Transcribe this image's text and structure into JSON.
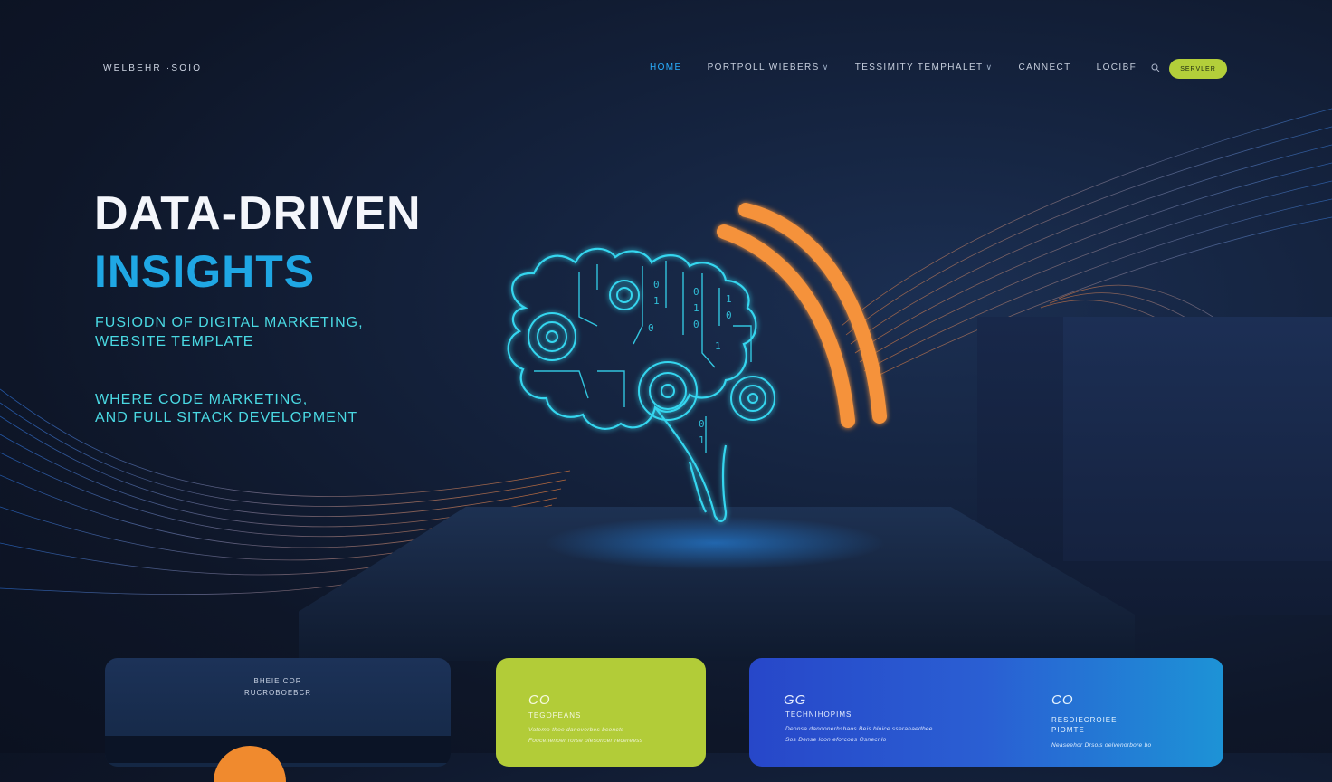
{
  "brand": {
    "name": "WELBEHR ·SOIO"
  },
  "nav": {
    "items": [
      {
        "label": "HOME",
        "active": true,
        "dropdown": false
      },
      {
        "label": "PORTPOLL WIEBERS",
        "active": false,
        "dropdown": true
      },
      {
        "label": "TESSIMITY TEMPHALET",
        "active": false,
        "dropdown": true
      },
      {
        "label": "CANNECT",
        "active": false,
        "dropdown": false
      },
      {
        "label": "LOCIBF",
        "active": false,
        "dropdown": false
      }
    ],
    "search_icon": "search-icon",
    "cta_label": "SERVLER"
  },
  "hero": {
    "title_line1": "DATA-DRIVEN",
    "title_line2": "INSIGHTS",
    "subtitle_line1": "FUSIODN OF DIGITAL MARKETING,",
    "subtitle_line2": "WEBSITE TEMPLATE",
    "tagline_line1": "WHERE  CODE MARKETING,",
    "tagline_line2": "AND FULL SITACK DEVELOPMENT"
  },
  "cards": [
    {
      "title_line1": "BHEIE COR",
      "title_line2": "RUCROBOEBCR"
    },
    {
      "icon": "CO",
      "title": "TEGOFEANS",
      "text_line1": "Vatemo thoe danoverbes bconcts",
      "text_line2": "Foocenenoer rorse oiesoncer recereess"
    },
    {
      "left": {
        "icon": "GG",
        "title": "TECHNIHOPIMS",
        "text_line1": "Deonsa danoonerhsbaos Beis bloice sseranaedbee",
        "text_line2": "Sos Dense loon eforcons Osnecnlo"
      },
      "right": {
        "icon": "CO",
        "title_line1": "RESDIECROIEE",
        "title_line2": "PIOMTE",
        "text_line1": "Neaseehor Drsois oelvenorbore bo"
      }
    }
  ],
  "colors": {
    "accent_blue": "#1fa7e4",
    "accent_cyan": "#4ad9e3",
    "cta_green": "#b3cf3a",
    "orange": "#f08a2e",
    "background": "#0e1628"
  }
}
